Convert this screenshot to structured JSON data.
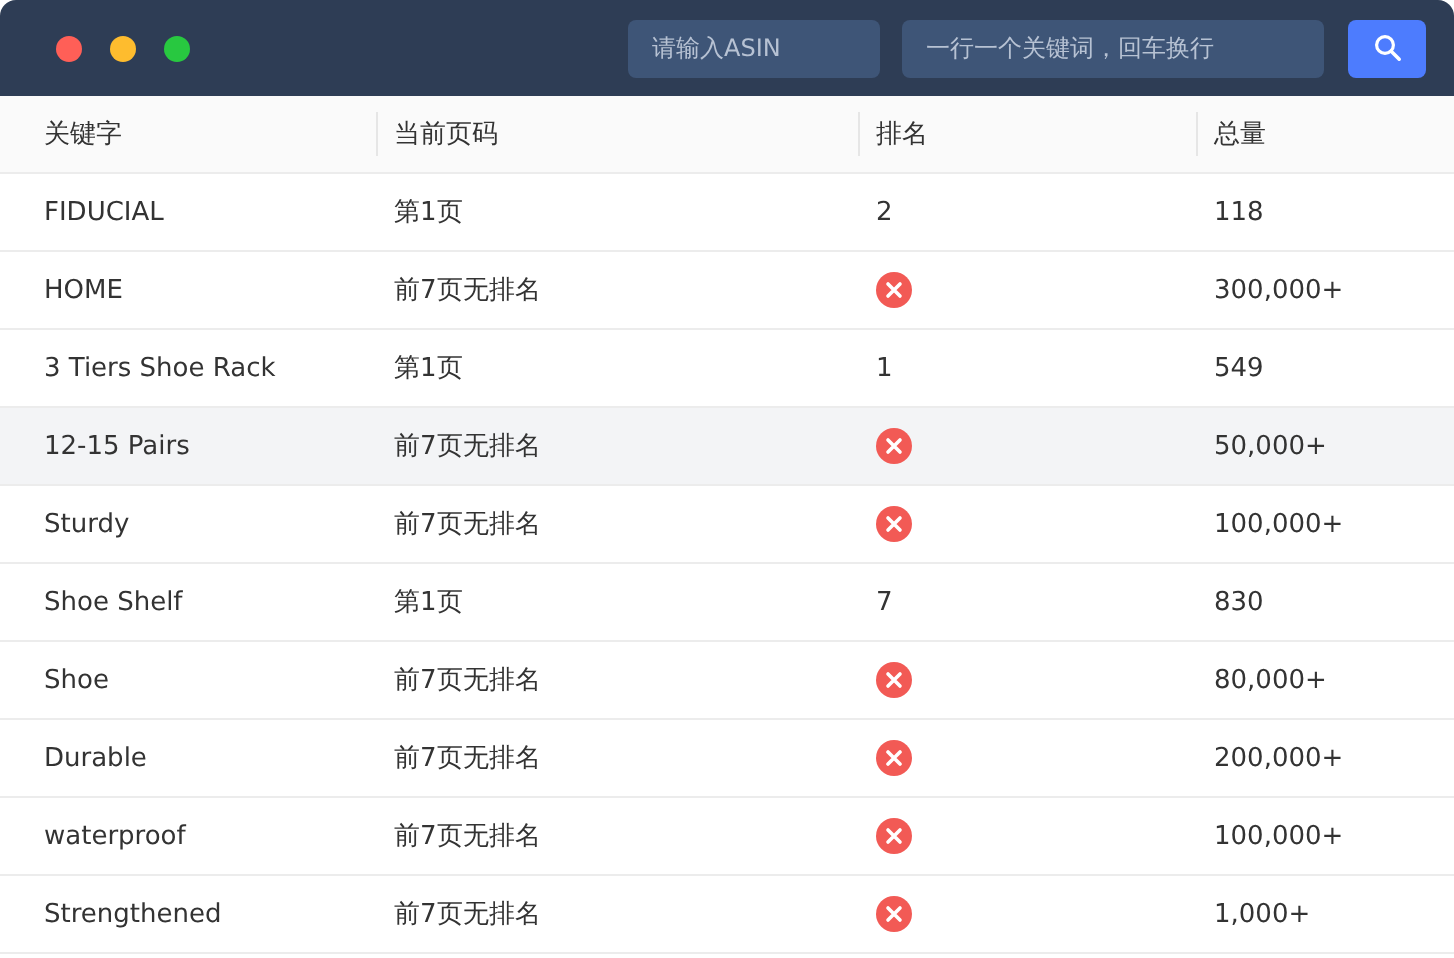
{
  "toolbar": {
    "asin_placeholder": "请输入ASIN",
    "keywords_placeholder": "一行一个关键词，回车换行"
  },
  "table": {
    "columns": [
      "关键字",
      "当前页码",
      "排名",
      "总量"
    ],
    "rows": [
      {
        "keyword": "FIDUCIAL",
        "page": "第1页",
        "rank": {
          "kind": "number",
          "text": "2"
        },
        "total": "118",
        "highlighted": false
      },
      {
        "keyword": "HOME",
        "page": "前7页无排名",
        "rank": {
          "kind": "none"
        },
        "total": "300,000+",
        "highlighted": false
      },
      {
        "keyword": "3 Tiers Shoe Rack",
        "page": "第1页",
        "rank": {
          "kind": "number",
          "text": "1"
        },
        "total": "549",
        "highlighted": false
      },
      {
        "keyword": "12-15 Pairs",
        "page": "前7页无排名",
        "rank": {
          "kind": "none"
        },
        "total": "50,000+",
        "highlighted": true
      },
      {
        "keyword": "Sturdy",
        "page": "前7页无排名",
        "rank": {
          "kind": "none"
        },
        "total": "100,000+",
        "highlighted": false
      },
      {
        "keyword": "Shoe Shelf",
        "page": "第1页",
        "rank": {
          "kind": "number",
          "text": "7"
        },
        "total": "830",
        "highlighted": false
      },
      {
        "keyword": "Shoe",
        "page": "前7页无排名",
        "rank": {
          "kind": "none"
        },
        "total": "80,000+",
        "highlighted": false
      },
      {
        "keyword": "Durable",
        "page": "前7页无排名",
        "rank": {
          "kind": "none"
        },
        "total": "200,000+",
        "highlighted": false
      },
      {
        "keyword": "waterproof",
        "page": "前7页无排名",
        "rank": {
          "kind": "none"
        },
        "total": "100,000+",
        "highlighted": false
      },
      {
        "keyword": "Strengthened",
        "page": "前7页无排名",
        "rank": {
          "kind": "none"
        },
        "total": "1,000+",
        "highlighted": false
      }
    ]
  }
}
